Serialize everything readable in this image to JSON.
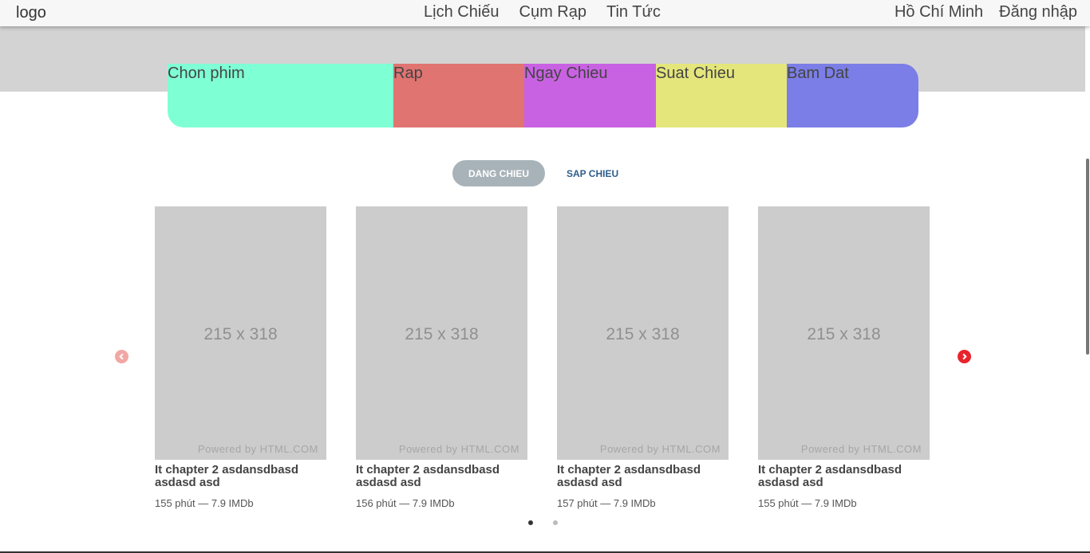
{
  "header": {
    "logo_alt": "logo",
    "nav": [
      "Lịch Chiếu",
      "Cụm Rạp",
      "Tin Tức"
    ],
    "location": "Hồ Chí Minh",
    "login": "Đăng nhập"
  },
  "booking": {
    "segments": [
      "Chon phim",
      "Rap",
      "Ngay Chieu",
      "Suat Chieu",
      "Bam Dat"
    ],
    "colors": [
      "#7fffd4",
      "#e07471",
      "#c862e2",
      "#e4e67c",
      "#7b7ee6"
    ]
  },
  "tabs": {
    "now_showing": "DANG CHIEU",
    "coming_soon": "SAP CHIEU",
    "active": "DANG CHIEU"
  },
  "movies": [
    {
      "poster_size": "215 x 318",
      "powered": "Powered by HTML.COM",
      "title": "It chapter 2 asdansdbasd asdasd asd",
      "duration": "155 phút",
      "sep": "—",
      "rating": "7.9 IMDb"
    },
    {
      "poster_size": "215 x 318",
      "powered": "Powered by HTML.COM",
      "title": "It chapter 2 asdansdbasd asdasd asd",
      "duration": "156 phút",
      "sep": "—",
      "rating": "7.9 IMDb"
    },
    {
      "poster_size": "215 x 318",
      "powered": "Powered by HTML.COM",
      "title": "It chapter 2 asdansdbasd asdasd asd",
      "duration": "157 phút",
      "sep": "—",
      "rating": "7.9 IMDb"
    },
    {
      "poster_size": "215 x 318",
      "powered": "Powered by HTML.COM",
      "title": "It chapter 2 asdansdbasd asdasd asd",
      "duration": "155 phút",
      "sep": "—",
      "rating": "7.9 IMDb"
    }
  ],
  "carousel": {
    "prev_icon": "chevron-left-icon",
    "next_icon": "chevron-right-icon",
    "pages": 2,
    "current_page": 1
  }
}
